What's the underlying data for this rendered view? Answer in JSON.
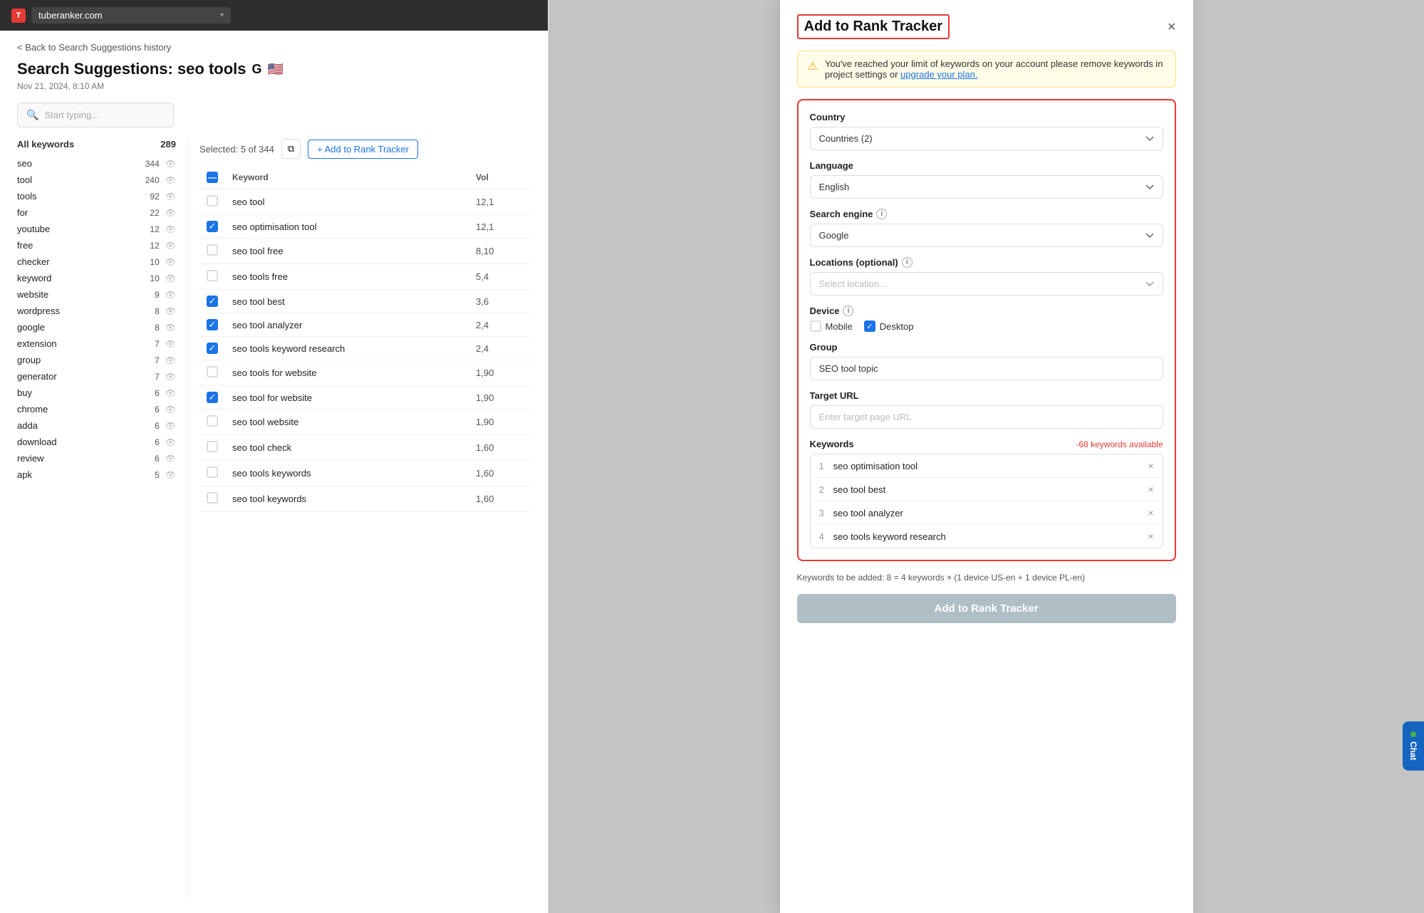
{
  "browser": {
    "url": "tuberanker.com",
    "favicon_letter": "T"
  },
  "page": {
    "back_link": "< Back to Search Suggestions history",
    "title": "Search Suggestions: seo tools",
    "date": "Nov 21, 2024, 8:10 AM"
  },
  "search": {
    "placeholder": "Start typing..."
  },
  "keyword_sidebar": {
    "all_keywords_label": "All keywords",
    "all_keywords_count": "289",
    "items": [
      {
        "name": "seo",
        "count": "344"
      },
      {
        "name": "tool",
        "count": "240"
      },
      {
        "name": "tools",
        "count": "92"
      },
      {
        "name": "for",
        "count": "22"
      },
      {
        "name": "youtube",
        "count": "12"
      },
      {
        "name": "free",
        "count": "12"
      },
      {
        "name": "checker",
        "count": "10"
      },
      {
        "name": "keyword",
        "count": "10"
      },
      {
        "name": "website",
        "count": "9"
      },
      {
        "name": "wordpress",
        "count": "8"
      },
      {
        "name": "google",
        "count": "8"
      },
      {
        "name": "extension",
        "count": "7"
      },
      {
        "name": "group",
        "count": "7"
      },
      {
        "name": "generator",
        "count": "7"
      },
      {
        "name": "buy",
        "count": "6"
      },
      {
        "name": "chrome",
        "count": "6"
      },
      {
        "name": "adda",
        "count": "6"
      },
      {
        "name": "download",
        "count": "6"
      },
      {
        "name": "review",
        "count": "6"
      },
      {
        "name": "apk",
        "count": "5"
      }
    ]
  },
  "toolbar": {
    "selected_label": "Selected: 5 of 344",
    "copy_icon": "⧉",
    "add_rank_label": "+ Add to Rank Tracker"
  },
  "table": {
    "columns": [
      "Keyword",
      "Vol"
    ],
    "rows": [
      {
        "keyword": "seo tool",
        "volume": "12,1",
        "checked": false
      },
      {
        "keyword": "seo optimisation tool",
        "volume": "12,1",
        "checked": true
      },
      {
        "keyword": "seo tool free",
        "volume": "8,10",
        "checked": false
      },
      {
        "keyword": "seo tools free",
        "volume": "5,4",
        "checked": false
      },
      {
        "keyword": "seo tool best",
        "volume": "3,6",
        "checked": true
      },
      {
        "keyword": "seo tool analyzer",
        "volume": "2,4",
        "checked": true
      },
      {
        "keyword": "seo tools keyword research",
        "volume": "2,4",
        "checked": true
      },
      {
        "keyword": "seo tools for website",
        "volume": "1,90",
        "checked": false
      },
      {
        "keyword": "seo tool for website",
        "volume": "1,90",
        "checked": true
      },
      {
        "keyword": "seo tool website",
        "volume": "1,90",
        "checked": false
      },
      {
        "keyword": "seo tool check",
        "volume": "1,60",
        "checked": false
      },
      {
        "keyword": "seo tools keywords",
        "volume": "1,60",
        "checked": false
      },
      {
        "keyword": "seo tool keywords",
        "volume": "1,60",
        "checked": false
      }
    ]
  },
  "modal": {
    "title": "Add to Rank Tracker",
    "close_label": "×",
    "warning_text": "You've reached your limit of keywords on your account please remove keywords in project settings or",
    "warning_link": "upgrade your plan.",
    "country_label": "Country",
    "country_value": "Countries (2)",
    "language_label": "Language",
    "language_value": "English",
    "search_engine_label": "Search engine",
    "search_engine_value": "Google",
    "locations_label": "Locations (optional)",
    "locations_placeholder": "Select location...",
    "device_label": "Device",
    "mobile_label": "Mobile",
    "desktop_label": "Desktop",
    "group_label": "Group",
    "group_value": "SEO tool topic",
    "target_url_label": "Target URL",
    "target_url_placeholder": "Enter target page URL",
    "keywords_label": "Keywords",
    "keywords_available": "-68 keywords available",
    "keywords_list": [
      {
        "num": "1",
        "text": "seo optimisation tool"
      },
      {
        "num": "2",
        "text": "seo tool best"
      },
      {
        "num": "3",
        "text": "seo tool analyzer"
      },
      {
        "num": "4",
        "text": "seo tools keyword research"
      }
    ],
    "keywords_to_add": "Keywords to be added: 8 = 4 keywords × (1 device US-en + 1 device PL-en)",
    "add_button_label": "Add to Rank Tracker",
    "chat_label": "Chat"
  }
}
